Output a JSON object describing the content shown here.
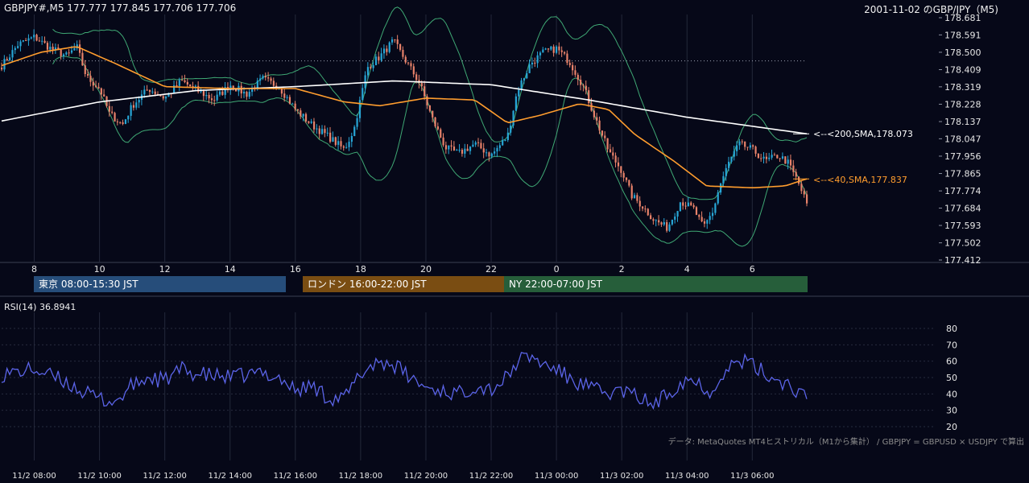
{
  "header": {
    "symbol_ohlc": "GBPJPY#,M5 177.777 177.845 177.706 177.706",
    "right_title": "2001-11-02 のGBP/JPY（M5)"
  },
  "sessions": [
    {
      "label": "東京 08:00-15:30 JST",
      "color": "#264d7a"
    },
    {
      "label": "ロンドン 16:00-22:00 JST",
      "color": "#7a4d12"
    },
    {
      "label": "NY 22:00-07:00 JST",
      "color": "#265e3a"
    }
  ],
  "ma_labels": {
    "ma200": "<--<200,SMA,178.073",
    "ma40": "<--<40,SMA,177.837"
  },
  "rsi_label": "RSI(14) 36.8941",
  "data_note": "データ: MetaQuotes MT4ヒストリカル（M1から集計） / GBPJPY = GBPUSD × USDJPY で算出",
  "colors": {
    "background": "#060818",
    "bull_candle": "#27a6d6",
    "bear_candle": "#e8826a",
    "sma40": "#ff9d2e",
    "sma200": "#ffffff",
    "bollinger": "#3fa874",
    "rsi": "#5b64e8"
  },
  "chart_data": [
    {
      "type": "candlestick",
      "title": "GBPJPY#,M5",
      "x_tick_labels": [
        "8",
        "10",
        "12",
        "14",
        "16",
        "18",
        "20",
        "22",
        "0",
        "2",
        "4",
        "6"
      ],
      "x_tick_hours": [
        8,
        10,
        12,
        14,
        16,
        18,
        20,
        22,
        24,
        26,
        28,
        30
      ],
      "x_range_hours": [
        7.0,
        31.67
      ],
      "y_tick_labels": [
        "178.681",
        "178.591",
        "178.500",
        "178.409",
        "178.319",
        "178.228",
        "178.137",
        "178.047",
        "177.956",
        "177.865",
        "177.774",
        "177.684",
        "177.593",
        "177.502",
        "177.412"
      ],
      "ylim": [
        177.412,
        178.681
      ],
      "reference_line": 178.455,
      "close_path": [
        [
          7.0,
          178.43
        ],
        [
          7.5,
          178.54
        ],
        [
          8.0,
          178.58
        ],
        [
          8.5,
          178.52
        ],
        [
          9.0,
          178.48
        ],
        [
          9.3,
          178.53
        ],
        [
          9.6,
          178.37
        ],
        [
          10.0,
          178.31
        ],
        [
          10.3,
          178.18
        ],
        [
          10.7,
          178.12
        ],
        [
          11.0,
          178.22
        ],
        [
          11.5,
          178.31
        ],
        [
          12.0,
          178.26
        ],
        [
          12.5,
          178.35
        ],
        [
          13.0,
          178.3
        ],
        [
          13.5,
          178.25
        ],
        [
          14.0,
          178.33
        ],
        [
          14.5,
          178.28
        ],
        [
          15.0,
          178.36
        ],
        [
          15.5,
          178.32
        ],
        [
          16.0,
          178.2
        ],
        [
          16.5,
          178.12
        ],
        [
          17.0,
          178.06
        ],
        [
          17.5,
          177.99
        ],
        [
          17.8,
          178.1
        ],
        [
          18.2,
          178.42
        ],
        [
          18.6,
          178.48
        ],
        [
          19.0,
          178.56
        ],
        [
          19.4,
          178.45
        ],
        [
          19.8,
          178.34
        ],
        [
          20.2,
          178.15
        ],
        [
          20.6,
          178.0
        ],
        [
          21.0,
          177.97
        ],
        [
          21.5,
          178.02
        ],
        [
          22.0,
          177.96
        ],
        [
          22.5,
          178.06
        ],
        [
          22.8,
          178.3
        ],
        [
          23.2,
          178.44
        ],
        [
          23.6,
          178.5
        ],
        [
          24.0,
          178.52
        ],
        [
          24.4,
          178.45
        ],
        [
          24.8,
          178.33
        ],
        [
          25.2,
          178.15
        ],
        [
          25.6,
          177.98
        ],
        [
          26.0,
          177.88
        ],
        [
          26.3,
          177.75
        ],
        [
          26.6,
          177.7
        ],
        [
          27.0,
          177.62
        ],
        [
          27.4,
          177.58
        ],
        [
          27.8,
          177.72
        ],
        [
          28.2,
          177.68
        ],
        [
          28.5,
          177.58
        ],
        [
          28.8,
          177.67
        ],
        [
          29.0,
          177.8
        ],
        [
          29.3,
          177.93
        ],
        [
          29.6,
          178.02
        ],
        [
          30.0,
          177.99
        ],
        [
          30.4,
          177.93
        ],
        [
          30.8,
          177.96
        ],
        [
          31.1,
          177.92
        ],
        [
          31.4,
          177.82
        ],
        [
          31.67,
          177.706
        ]
      ],
      "sma200": [
        [
          7.0,
          178.14
        ],
        [
          10.0,
          178.24
        ],
        [
          13.0,
          178.3
        ],
        [
          16.0,
          178.32
        ],
        [
          19.0,
          178.35
        ],
        [
          22.0,
          178.33
        ],
        [
          25.0,
          178.25
        ],
        [
          28.0,
          178.16
        ],
        [
          31.67,
          178.073
        ]
      ],
      "sma40": [
        [
          7.0,
          178.43
        ],
        [
          8.2,
          178.5
        ],
        [
          9.3,
          178.53
        ],
        [
          10.5,
          178.44
        ],
        [
          12.0,
          178.32
        ],
        [
          14.0,
          178.31
        ],
        [
          16.0,
          178.31
        ],
        [
          17.5,
          178.24
        ],
        [
          18.6,
          178.22
        ],
        [
          20.0,
          178.26
        ],
        [
          21.5,
          178.25
        ],
        [
          22.5,
          178.13
        ],
        [
          23.5,
          178.17
        ],
        [
          24.7,
          178.23
        ],
        [
          25.6,
          178.2
        ],
        [
          26.4,
          178.07
        ],
        [
          27.6,
          177.93
        ],
        [
          28.6,
          177.8
        ],
        [
          30.0,
          177.79
        ],
        [
          31.0,
          177.8
        ],
        [
          31.67,
          177.837
        ]
      ],
      "series": [
        {
          "name": "200,SMA,178.073"
        },
        {
          "name": "40,SMA,177.837"
        }
      ]
    },
    {
      "type": "line",
      "title": "RSI(14) 36.8941",
      "y_tick_labels": [
        "80",
        "70",
        "60",
        "50",
        "40",
        "30",
        "20"
      ],
      "ylim": [
        20,
        80
      ],
      "x_tick_labels": [
        "11/2 08:00",
        "11/2 10:00",
        "11/2 12:00",
        "11/2 14:00",
        "11/2 16:00",
        "11/2 18:00",
        "11/2 20:00",
        "11/2 22:00",
        "11/3 00:00",
        "11/3 02:00",
        "11/3 04:00",
        "11/3 06:00"
      ],
      "x_range_hours": [
        7.0,
        31.67
      ],
      "rsi_path": [
        [
          7.0,
          52
        ],
        [
          8.0,
          55
        ],
        [
          9.0,
          47
        ],
        [
          9.6,
          40
        ],
        [
          10.0,
          37
        ],
        [
          10.5,
          35
        ],
        [
          11.0,
          45
        ],
        [
          11.5,
          50
        ],
        [
          12.0,
          48
        ],
        [
          12.5,
          55
        ],
        [
          13.0,
          52
        ],
        [
          14.0,
          50
        ],
        [
          15.0,
          53
        ],
        [
          15.5,
          50
        ],
        [
          16.0,
          42
        ],
        [
          16.5,
          45
        ],
        [
          17.0,
          38
        ],
        [
          17.5,
          37
        ],
        [
          18.0,
          52
        ],
        [
          18.5,
          60
        ],
        [
          19.0,
          58
        ],
        [
          19.5,
          50
        ],
        [
          20.0,
          44
        ],
        [
          20.5,
          42
        ],
        [
          21.0,
          40
        ],
        [
          21.5,
          45
        ],
        [
          22.0,
          43
        ],
        [
          22.5,
          50
        ],
        [
          22.8,
          60
        ],
        [
          23.2,
          63
        ],
        [
          23.6,
          58
        ],
        [
          24.0,
          55
        ],
        [
          24.5,
          48
        ],
        [
          25.0,
          44
        ],
        [
          25.5,
          40
        ],
        [
          26.0,
          42
        ],
        [
          26.5,
          38
        ],
        [
          27.0,
          33
        ],
        [
          27.5,
          42
        ],
        [
          28.0,
          50
        ],
        [
          28.5,
          45
        ],
        [
          28.8,
          40
        ],
        [
          29.0,
          52
        ],
        [
          29.4,
          58
        ],
        [
          29.8,
          60
        ],
        [
          30.2,
          55
        ],
        [
          30.6,
          50
        ],
        [
          31.0,
          47
        ],
        [
          31.3,
          43
        ],
        [
          31.67,
          36.89
        ]
      ]
    }
  ]
}
